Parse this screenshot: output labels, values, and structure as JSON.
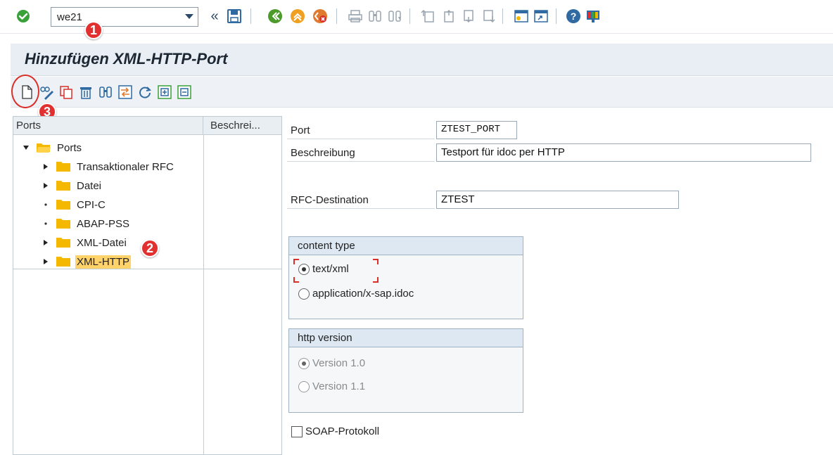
{
  "system_toolbar": {
    "command_field_value": "we21",
    "icons": [
      "enter-check-icon",
      "double-left-icon",
      "save-icon",
      "back-icon",
      "exit-icon",
      "cancel-icon",
      "print-icon",
      "find-icon",
      "find-next-icon",
      "first-page-icon",
      "previous-page-icon",
      "next-page-icon",
      "last-page-icon",
      "create-session-icon",
      "shortcut-icon",
      "help-icon",
      "customize-layout-icon"
    ]
  },
  "title": "Hinzufügen XML-HTTP-Port",
  "app_toolbar": {
    "icons": [
      "create-icon",
      "change-icon",
      "copy-icon",
      "delete-icon",
      "find-icon",
      "transfer-icon",
      "refresh-icon",
      "expand-icon",
      "collapse-icon"
    ]
  },
  "tree": {
    "col1_header": "Ports",
    "col2_header": "Beschrei...",
    "root_label": "Ports",
    "items": [
      {
        "label": "Transaktionaler RFC"
      },
      {
        "label": "Datei"
      },
      {
        "label": "CPI-C"
      },
      {
        "label": "ABAP-PSS"
      },
      {
        "label": "XML-Datei"
      },
      {
        "label": "XML-HTTP"
      }
    ]
  },
  "form": {
    "port_label": "Port",
    "port_value": "ZTEST_PORT",
    "description_label": "Beschreibung",
    "description_value": "Testport für idoc per HTTP",
    "rfc_label": "RFC-Destination",
    "rfc_value": "ZTEST"
  },
  "content_type": {
    "title": "content type",
    "options": [
      "text/xml",
      "application/x-sap.idoc"
    ],
    "selected": "text/xml"
  },
  "http_version": {
    "title": "http version",
    "options": [
      "Version 1.0",
      "Version 1.1"
    ],
    "selected": "Version 1.0"
  },
  "soap_label": "SOAP-Protokoll",
  "annotations": {
    "badge1": "1",
    "badge2": "2",
    "badge3": "3"
  },
  "colors": {
    "badge": "#e23030",
    "selection": "#ffd36a",
    "folder": "#f5b800"
  }
}
